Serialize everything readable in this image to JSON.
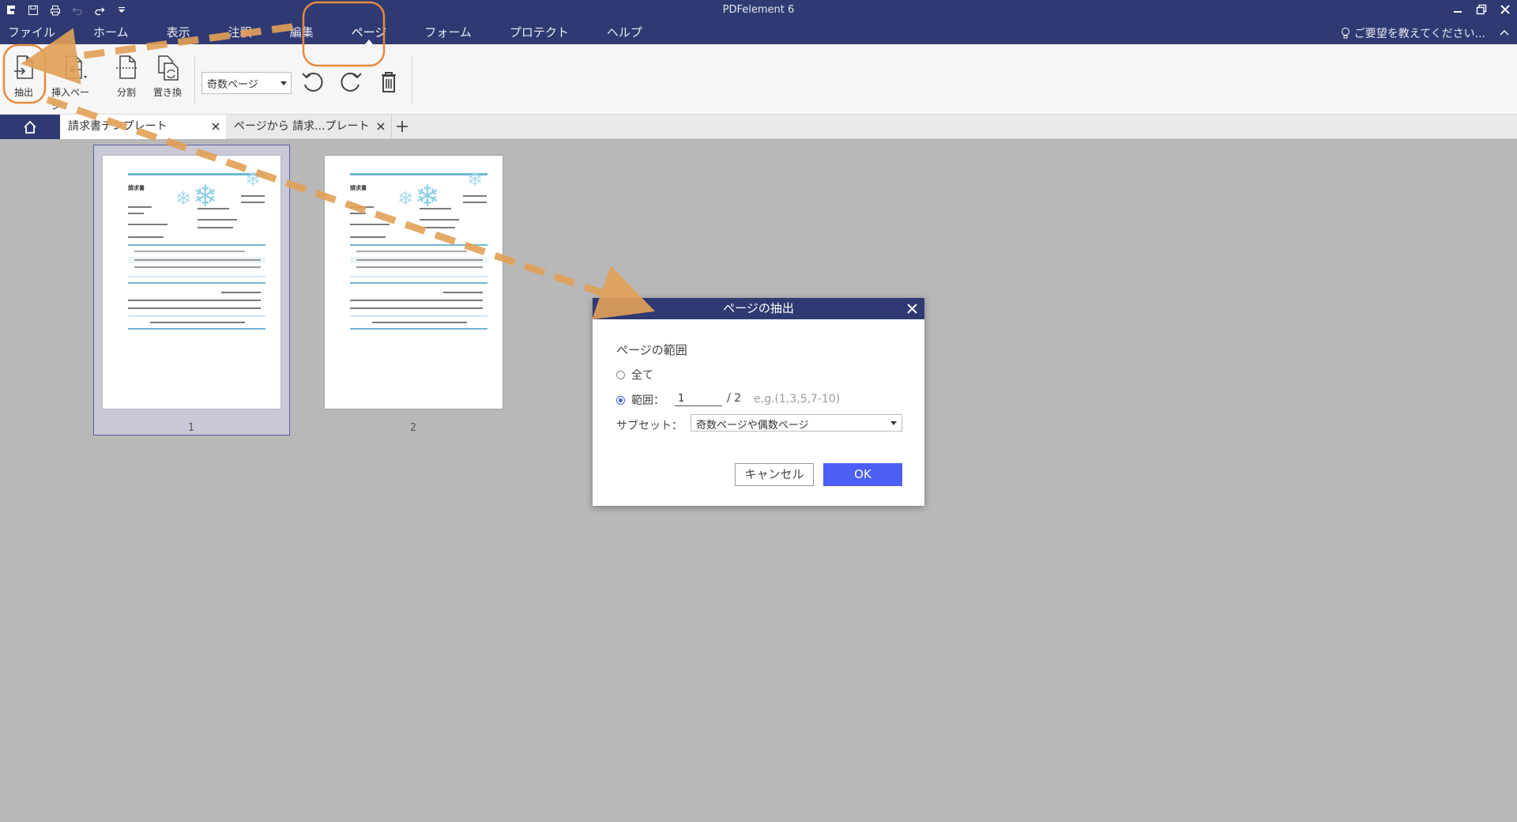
{
  "app": {
    "title": "PDFelement 6"
  },
  "menu": [
    {
      "label": "ファイル"
    },
    {
      "label": "ホーム"
    },
    {
      "label": "表示"
    },
    {
      "label": "注釈"
    },
    {
      "label": "編集"
    },
    {
      "label": "ページ",
      "active": true
    },
    {
      "label": "フォーム"
    },
    {
      "label": "プロテクト"
    },
    {
      "label": "ヘルプ"
    }
  ],
  "feedback": "ご要望を教えてください...",
  "toolbar": {
    "extract": "抽出",
    "insert": "挿入ページ",
    "split": "分割",
    "replace": "置き換",
    "page_filter": "奇数ページ"
  },
  "tabs": [
    {
      "label": "請求書テンプレート",
      "active": true
    },
    {
      "label": "ページから 請求...プレート",
      "active": false
    }
  ],
  "pages": [
    {
      "number": "1",
      "selected": true
    },
    {
      "number": "2",
      "selected": false
    }
  ],
  "thumbnail_text": {
    "doc_title": "請求書"
  },
  "dialog": {
    "title": "ページの抽出",
    "section": "ページの範囲",
    "all_label": "全て",
    "range_label": "範囲：",
    "range_value": "1",
    "range_total": "/   2",
    "range_hint": "e.g.(1,3,5,7-10)",
    "subset_label": "サブセット：",
    "subset_value": "奇数ページや偶数ページ",
    "cancel": "キャンセル",
    "ok": "OK"
  },
  "colors": {
    "navy": "#2f3a73",
    "accent_blue": "#4b5ef5",
    "annotation_orange": "#e98a3c",
    "canvas_gray": "#b8b8b8"
  }
}
